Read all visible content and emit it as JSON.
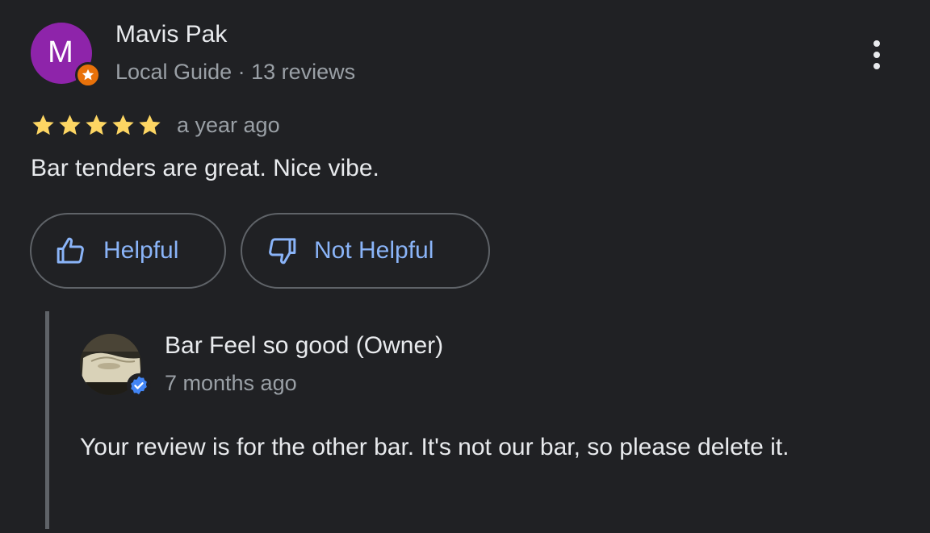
{
  "review": {
    "avatar_letter": "M",
    "avatar_color": "#8e24aa",
    "badge_icon": "local-guide-star-icon",
    "reviewer_name": "Mavis Pak",
    "reviewer_meta": "Local Guide · 13 reviews",
    "rating": 5,
    "rating_max": 5,
    "star_color": "#fdd663",
    "time": "a year ago",
    "text": "Bar tenders are great. Nice vibe.",
    "more_icon": "more-vert-icon"
  },
  "actions": {
    "helpful_label": "Helpful",
    "helpful_icon": "thumbs-up-icon",
    "not_helpful_label": "Not Helpful",
    "not_helpful_icon": "thumbs-down-icon"
  },
  "owner_reply": {
    "owner_name": "Bar Feel so good (Owner)",
    "verified_icon": "verified-check-icon",
    "time": "7 months ago",
    "text": "Your review is for the other bar. It's not our bar, so please delete it."
  },
  "colors": {
    "background": "#202124",
    "link": "#8ab4f8",
    "secondary_text": "#9aa0a6",
    "badge_orange": "#e8710a",
    "verified_blue": "#1a73e8"
  }
}
